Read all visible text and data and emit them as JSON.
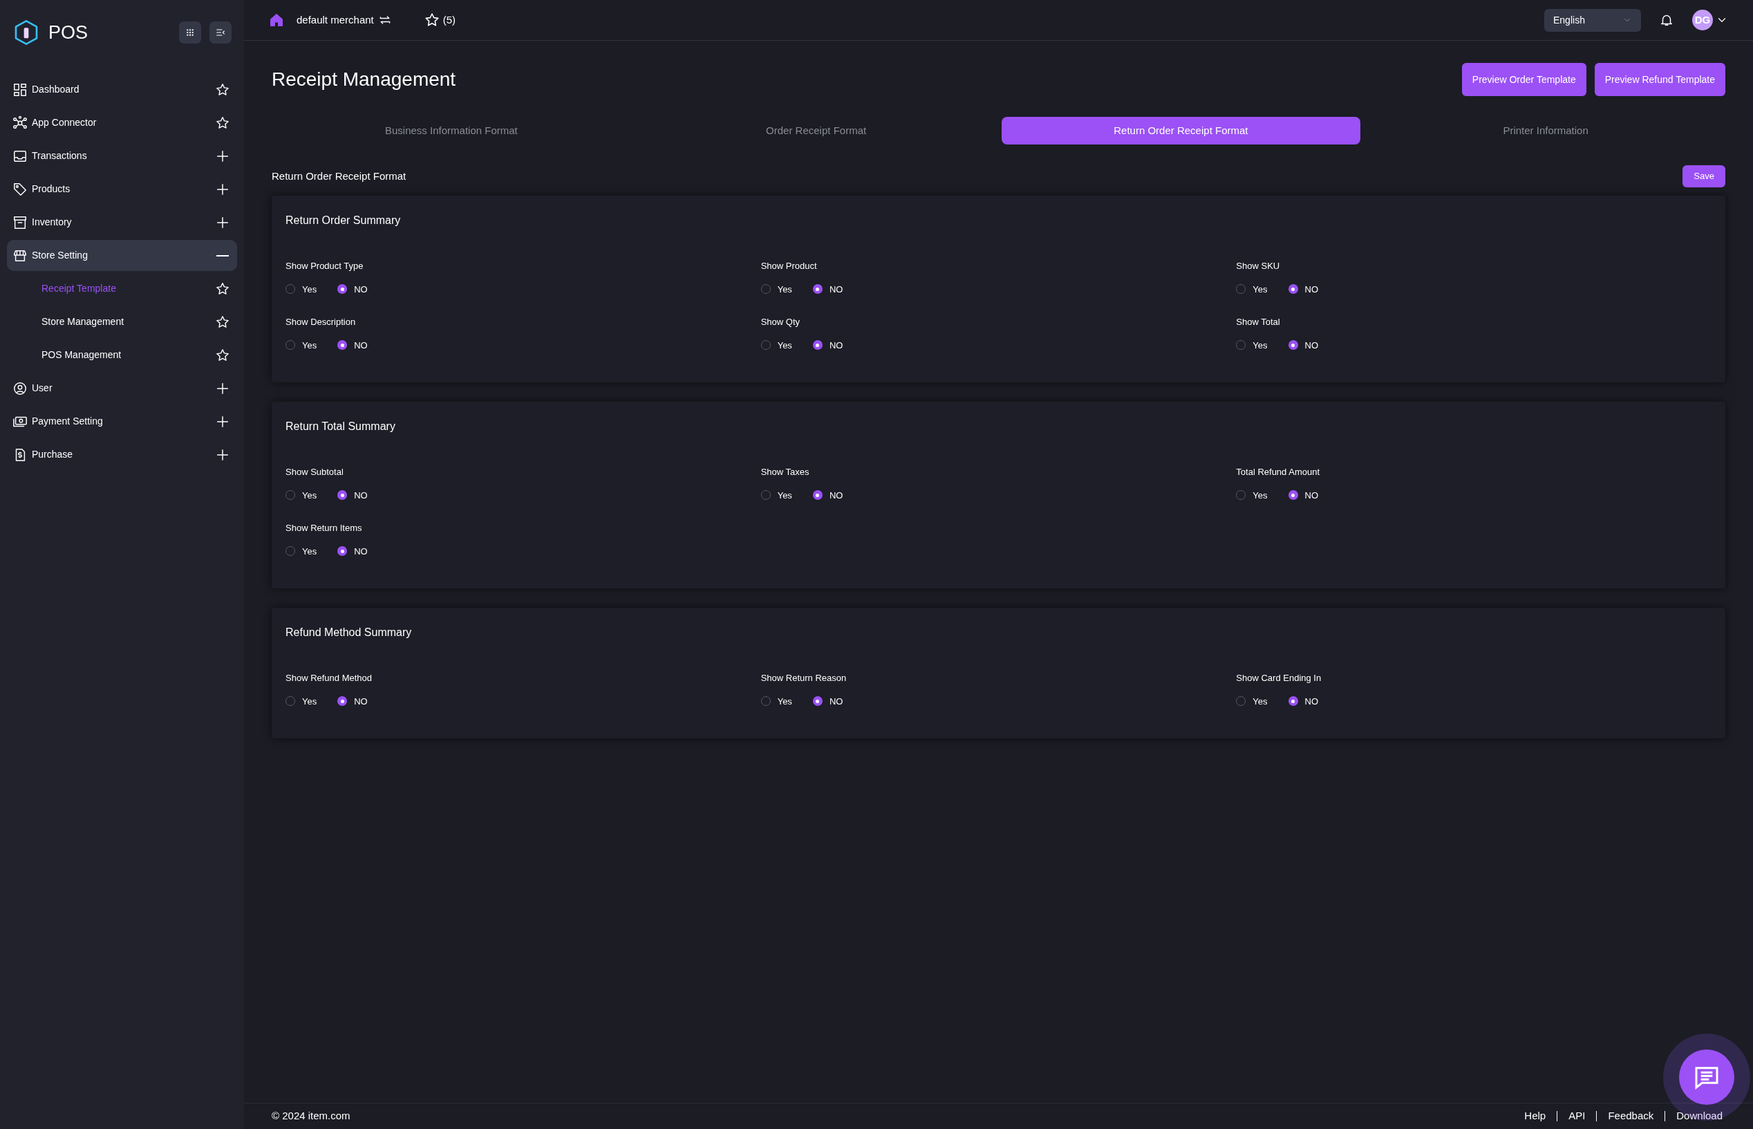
{
  "sidebar": {
    "logo": "POS",
    "items": [
      {
        "label": "Dashboard",
        "kind": "link",
        "selected": false
      },
      {
        "label": "App Connector",
        "kind": "link",
        "selected": false
      },
      {
        "label": "Transactions",
        "kind": "group",
        "expanded": false,
        "selected": false
      },
      {
        "label": "Products",
        "kind": "group",
        "expanded": false,
        "selected": false
      },
      {
        "label": "Inventory",
        "kind": "group",
        "expanded": false,
        "selected": false
      },
      {
        "label": "Store Setting",
        "kind": "group",
        "expanded": true,
        "selected": true,
        "children": [
          {
            "label": "Receipt Template",
            "kind": "link",
            "selected": true
          },
          {
            "label": "Store Management",
            "kind": "link",
            "selected": false
          },
          {
            "label": "POS Management",
            "kind": "link",
            "selected": false
          }
        ]
      },
      {
        "label": "User",
        "kind": "group",
        "expanded": false,
        "selected": false
      },
      {
        "label": "Payment Setting",
        "kind": "group",
        "expanded": false,
        "selected": false
      },
      {
        "label": "Purchase",
        "kind": "group",
        "expanded": false,
        "selected": false
      }
    ]
  },
  "topbar": {
    "merchant": "default merchant",
    "favorites": "(5)",
    "language": "English",
    "avatar": "DG"
  },
  "page": {
    "title": "Receipt Management",
    "buttons": [
      "Preview Order Template",
      "Preview Refund Template"
    ]
  },
  "tabs": [
    {
      "label": "Business Information Format",
      "selected": false
    },
    {
      "label": "Order Receipt Format",
      "selected": false
    },
    {
      "label": "Return Order Receipt Format",
      "selected": true
    },
    {
      "label": "Printer Information",
      "selected": false
    }
  ],
  "form": {
    "title": "Return Order Receipt Format",
    "save": "Save",
    "sections": [
      {
        "title": "Return Order Summary",
        "fields": [
          {
            "label": "Show Product Type",
            "options": [
              {
                "label": "Yes",
                "selected": false
              },
              {
                "label": "NO",
                "selected": true
              }
            ]
          },
          {
            "label": "Show Product",
            "options": [
              {
                "label": "Yes",
                "selected": false
              },
              {
                "label": "NO",
                "selected": true
              }
            ]
          },
          {
            "label": "Show SKU",
            "options": [
              {
                "label": "Yes",
                "selected": false
              },
              {
                "label": "NO",
                "selected": true
              }
            ]
          },
          {
            "label": "Show Description",
            "options": [
              {
                "label": "Yes",
                "selected": false
              },
              {
                "label": "NO",
                "selected": true
              }
            ]
          },
          {
            "label": "Show Qty",
            "options": [
              {
                "label": "Yes",
                "selected": false
              },
              {
                "label": "NO",
                "selected": true
              }
            ]
          },
          {
            "label": "Show Total",
            "options": [
              {
                "label": "Yes",
                "selected": false
              },
              {
                "label": "NO",
                "selected": true
              }
            ]
          }
        ]
      },
      {
        "title": "Return Total Summary",
        "fields": [
          {
            "label": "Show Subtotal",
            "options": [
              {
                "label": "Yes",
                "selected": false
              },
              {
                "label": "NO",
                "selected": true
              }
            ]
          },
          {
            "label": "Show Taxes",
            "options": [
              {
                "label": "Yes",
                "selected": false
              },
              {
                "label": "NO",
                "selected": true
              }
            ]
          },
          {
            "label": "Total Refund Amount",
            "options": [
              {
                "label": "Yes",
                "selected": false
              },
              {
                "label": "NO",
                "selected": true
              }
            ]
          },
          {
            "label": "Show Return Items",
            "options": [
              {
                "label": "Yes",
                "selected": false
              },
              {
                "label": "NO",
                "selected": true
              }
            ]
          }
        ]
      },
      {
        "title": "Refund Method Summary",
        "fields": [
          {
            "label": "Show Refund Method",
            "options": [
              {
                "label": "Yes",
                "selected": false
              },
              {
                "label": "NO",
                "selected": true
              }
            ]
          },
          {
            "label": "Show Return Reason",
            "options": [
              {
                "label": "Yes",
                "selected": false
              },
              {
                "label": "NO",
                "selected": true
              }
            ]
          },
          {
            "label": "Show Card Ending In",
            "options": [
              {
                "label": "Yes",
                "selected": false
              },
              {
                "label": "NO",
                "selected": true
              }
            ]
          }
        ]
      }
    ]
  },
  "footer": {
    "copyright": "© 2024 item.com",
    "links": [
      "Help",
      "API",
      "Feedback",
      "Download"
    ]
  }
}
